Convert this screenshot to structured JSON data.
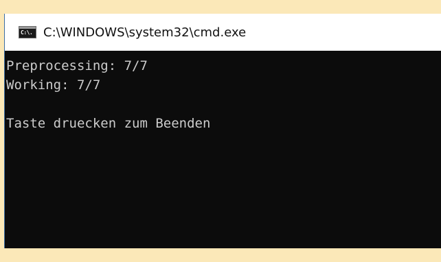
{
  "window": {
    "title": "C:\\WINDOWS\\system32\\cmd.exe",
    "icon": "cmd-console-icon",
    "icon_label": "C:\\."
  },
  "console": {
    "lines": [
      "Preprocessing: 7/7",
      "Working: 7/7",
      "",
      "Taste druecken zum Beenden"
    ]
  },
  "colors": {
    "background": "#fbe8b8",
    "console_bg": "#0c0c0c",
    "console_text": "#cccccc",
    "titlebar_bg": "#ffffff"
  }
}
